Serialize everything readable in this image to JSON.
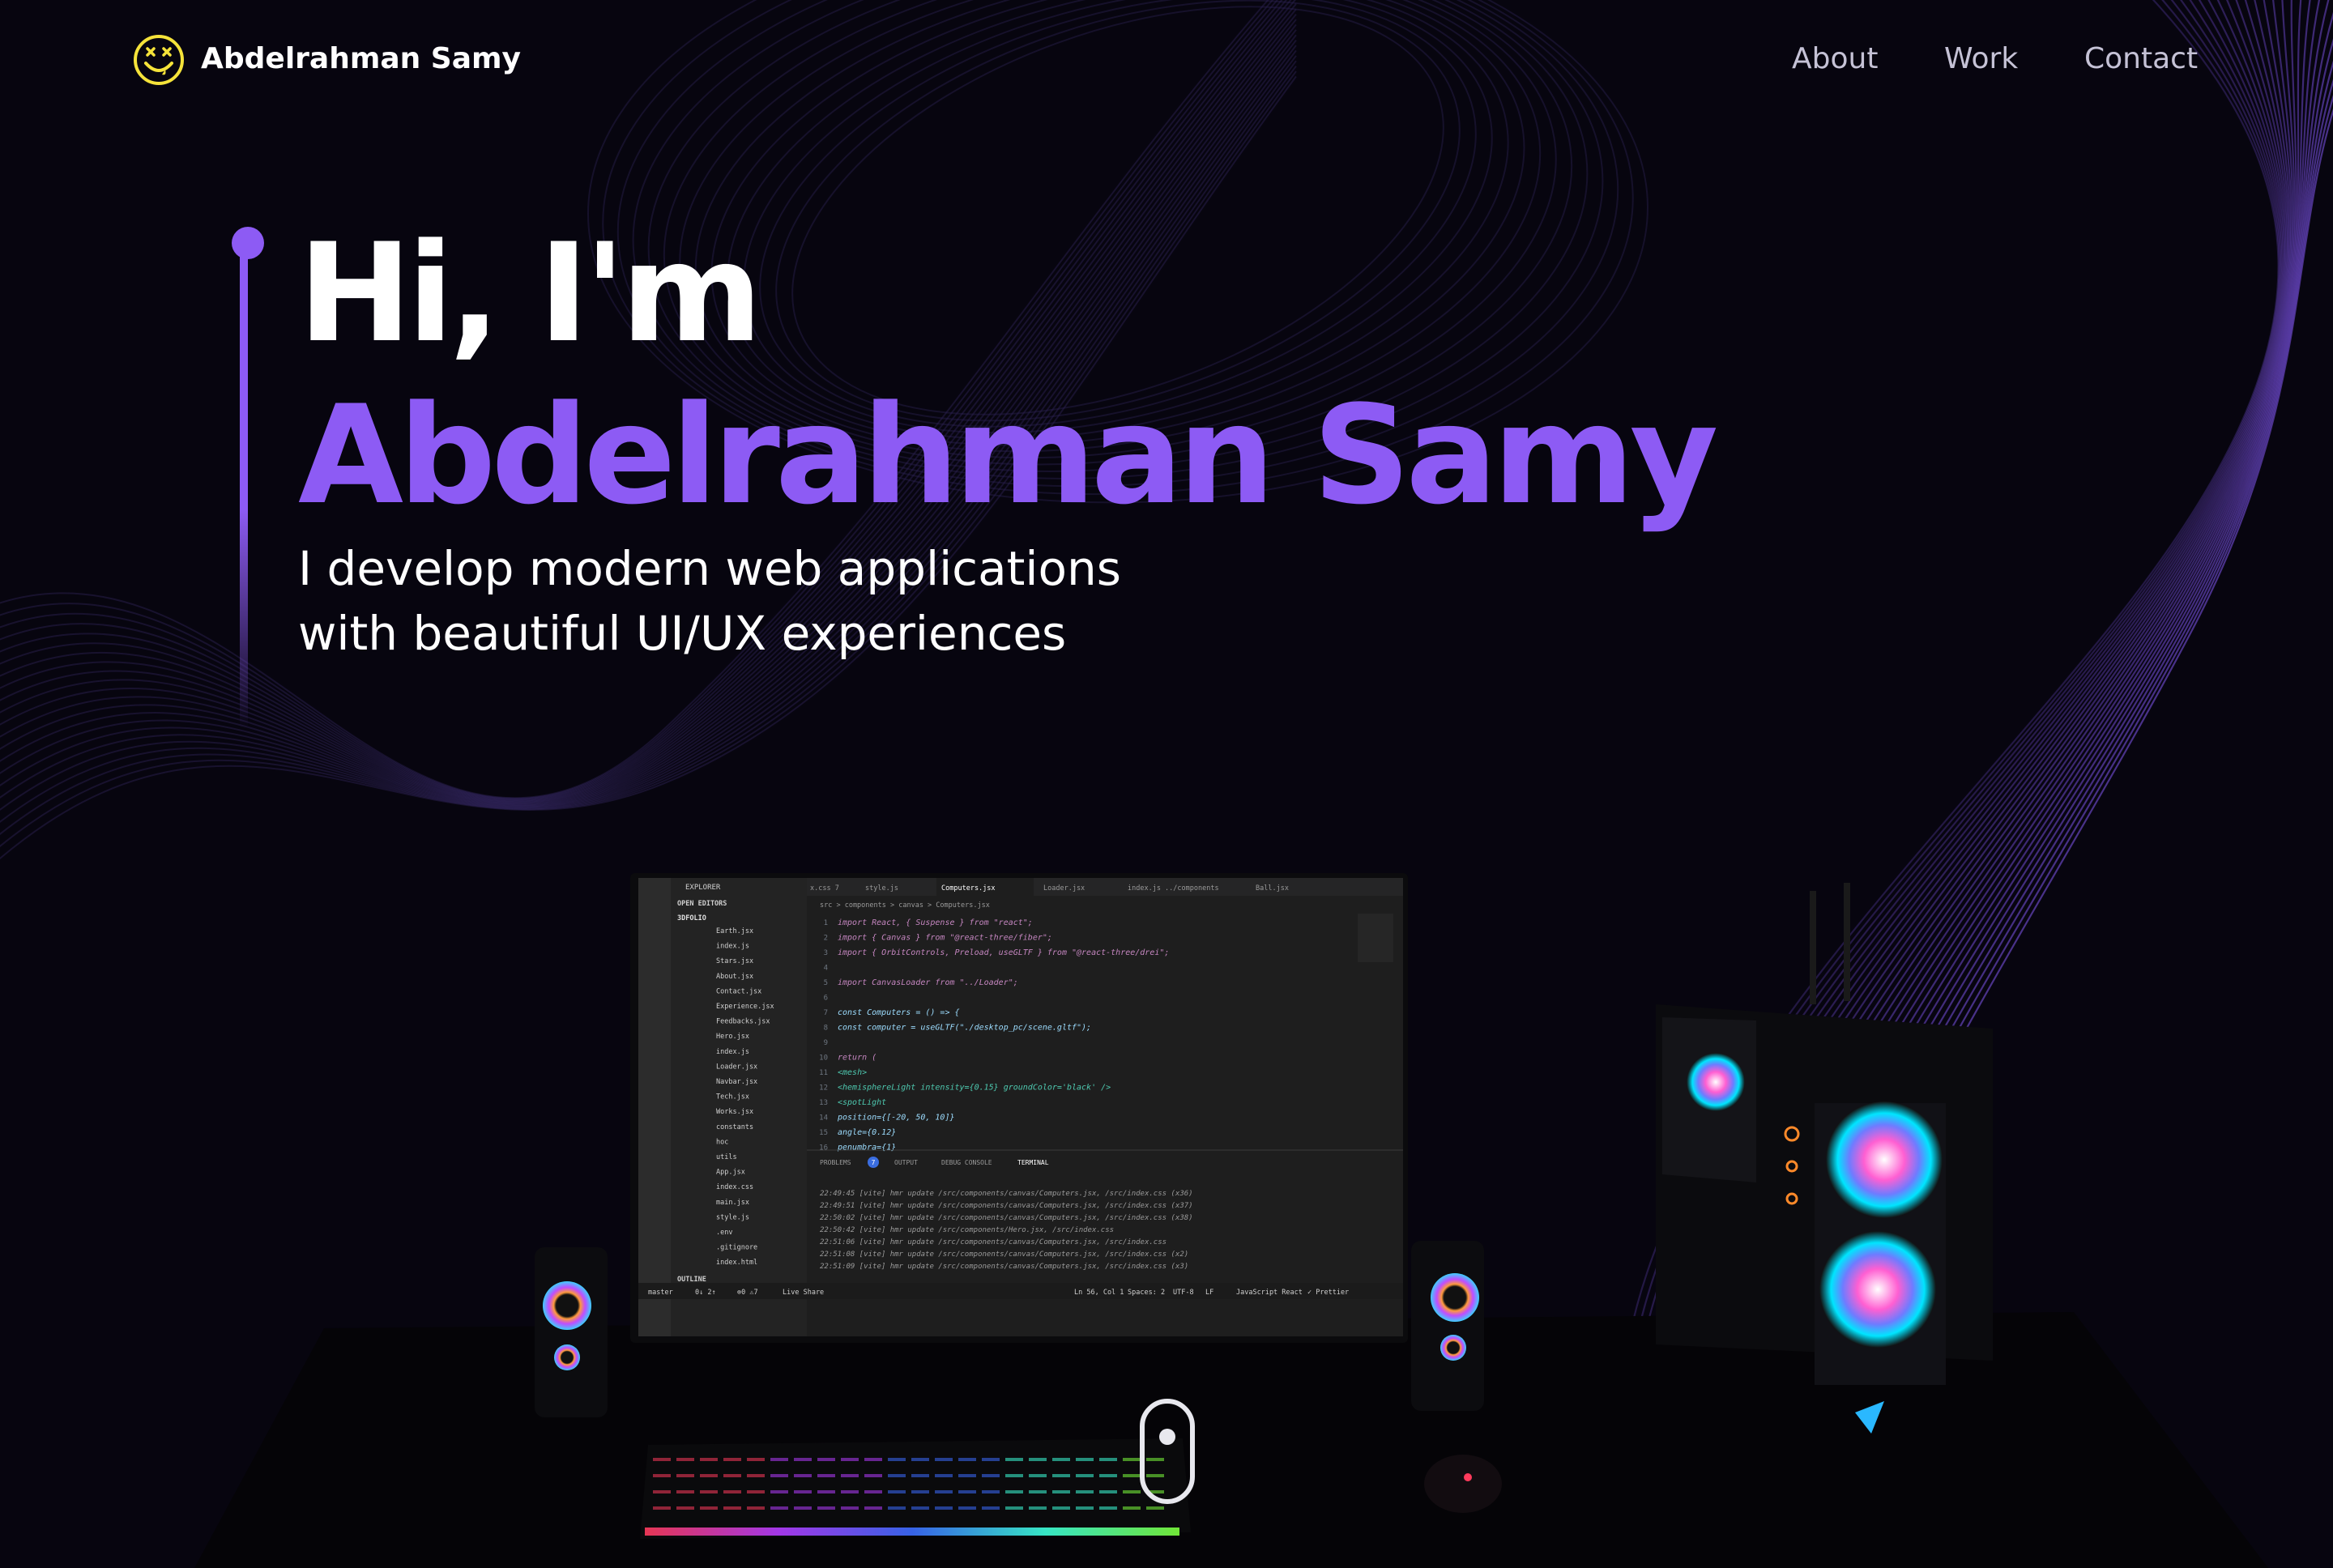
{
  "nav": {
    "brand": "Abdelrahman Samy",
    "links": [
      "About",
      "Work",
      "Contact"
    ]
  },
  "hero": {
    "title_prefix": "Hi, I'm ",
    "title_highlight": "Abdelrahman Samy",
    "subtitle_line1": "I develop modern web applications",
    "subtitle_line2": "with beautiful UI/UX experiences"
  },
  "editor": {
    "explorer_title": "EXPLORER",
    "open_editors": "OPEN EDITORS",
    "project": "3DFOLIO",
    "tabs": [
      "x.css 7",
      "style.js",
      "Computers.jsx",
      "Loader.jsx",
      "index.js ../components",
      "Ball.jsx"
    ],
    "breadcrumb": "src > components > canvas > Computers.jsx",
    "files": [
      "Earth.jsx",
      "index.js",
      "Stars.jsx",
      "About.jsx",
      "Contact.jsx",
      "Experience.jsx",
      "Feedbacks.jsx",
      "Hero.jsx",
      "index.js",
      "Loader.jsx",
      "Navbar.jsx",
      "Tech.jsx",
      "Works.jsx",
      "constants",
      "hoc",
      "utils",
      "App.jsx",
      "index.css",
      "main.jsx",
      "style.js",
      ".env",
      ".gitignore",
      "index.html"
    ],
    "outline": "OUTLINE",
    "code": [
      "import React, { Suspense } from \"react\";",
      "import { Canvas } from \"@react-three/fiber\";",
      "import { OrbitControls, Preload, useGLTF } from \"@react-three/drei\";",
      "",
      "import CanvasLoader from \"../Loader\";",
      "",
      "const Computers = () => {",
      "  const computer = useGLTF(\"./desktop_pc/scene.gltf\");",
      "",
      "  return (",
      "    <mesh>",
      "      <hemisphereLight intensity={0.15} groundColor='black' />",
      "      <spotLight",
      "        position={[-20, 50, 10]}",
      "        angle={0.12}",
      "        penumbra={1}"
    ],
    "panel_tabs": [
      "PROBLEMS",
      "OUTPUT",
      "DEBUG CONSOLE",
      "TERMINAL"
    ],
    "problems_count": "7",
    "terminal": [
      "22:49:45 [vite] hmr update /src/components/canvas/Computers.jsx, /src/index.css (x36)",
      "22:49:51 [vite] hmr update /src/components/canvas/Computers.jsx, /src/index.css (x37)",
      "22:50:02 [vite] hmr update /src/components/canvas/Computers.jsx, /src/index.css (x38)",
      "22:50:42 [vite] hmr update /src/components/Hero.jsx, /src/index.css",
      "22:51:06 [vite] hmr update /src/components/canvas/Computers.jsx, /src/index.css",
      "22:51:08 [vite] hmr update /src/components/canvas/Computers.jsx, /src/index.css (x2)",
      "22:51:09 [vite] hmr update /src/components/canvas/Computers.jsx, /src/index.css (x3)"
    ],
    "status_left": [
      "master",
      "0↓ 2↑",
      "⊗0 ⚠7",
      "Live Share"
    ],
    "status_right": [
      "Ln 56, Col 1",
      "Spaces: 2",
      "UTF-8",
      "LF",
      "JavaScript React",
      "✓ Prettier"
    ]
  },
  "colors": {
    "accent": "#8d5bf4",
    "background": "#07050f",
    "text": "#ffffff",
    "nav_text": "#c5c2d6",
    "logo": "#f5e33a",
    "wave": "#5a3ca8"
  }
}
